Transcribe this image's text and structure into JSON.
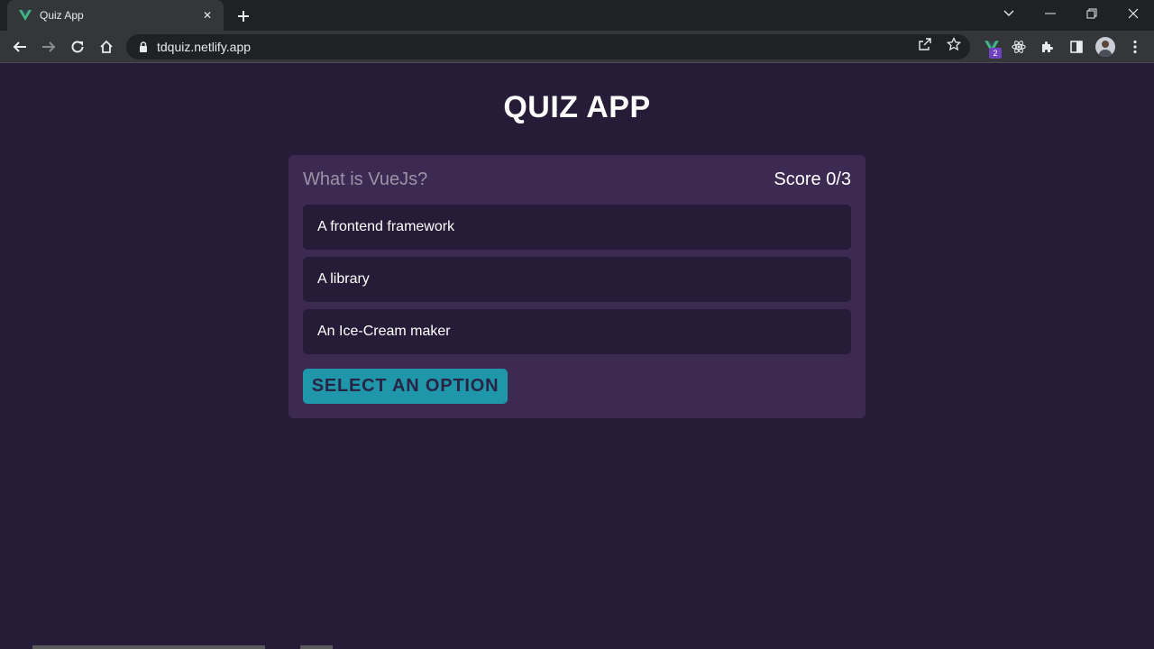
{
  "browser": {
    "tab_title": "Quiz App",
    "url": "tdquiz.netlify.app",
    "extension_badge": "2",
    "colors": {
      "tabstrip": "#202124",
      "toolbar": "#35363a",
      "favicon": "#41b883"
    }
  },
  "app": {
    "title": "QUIZ APP",
    "question": "What is VueJs?",
    "score": "Score 0/3",
    "options": [
      "A frontend framework",
      "A library",
      "An Ice-Cream maker"
    ],
    "submit_label": "SELECT AN OPTION",
    "colors": {
      "background": "#261c37",
      "card": "#3c2a52",
      "option": "#271c37",
      "button": "#1f96aa"
    }
  }
}
